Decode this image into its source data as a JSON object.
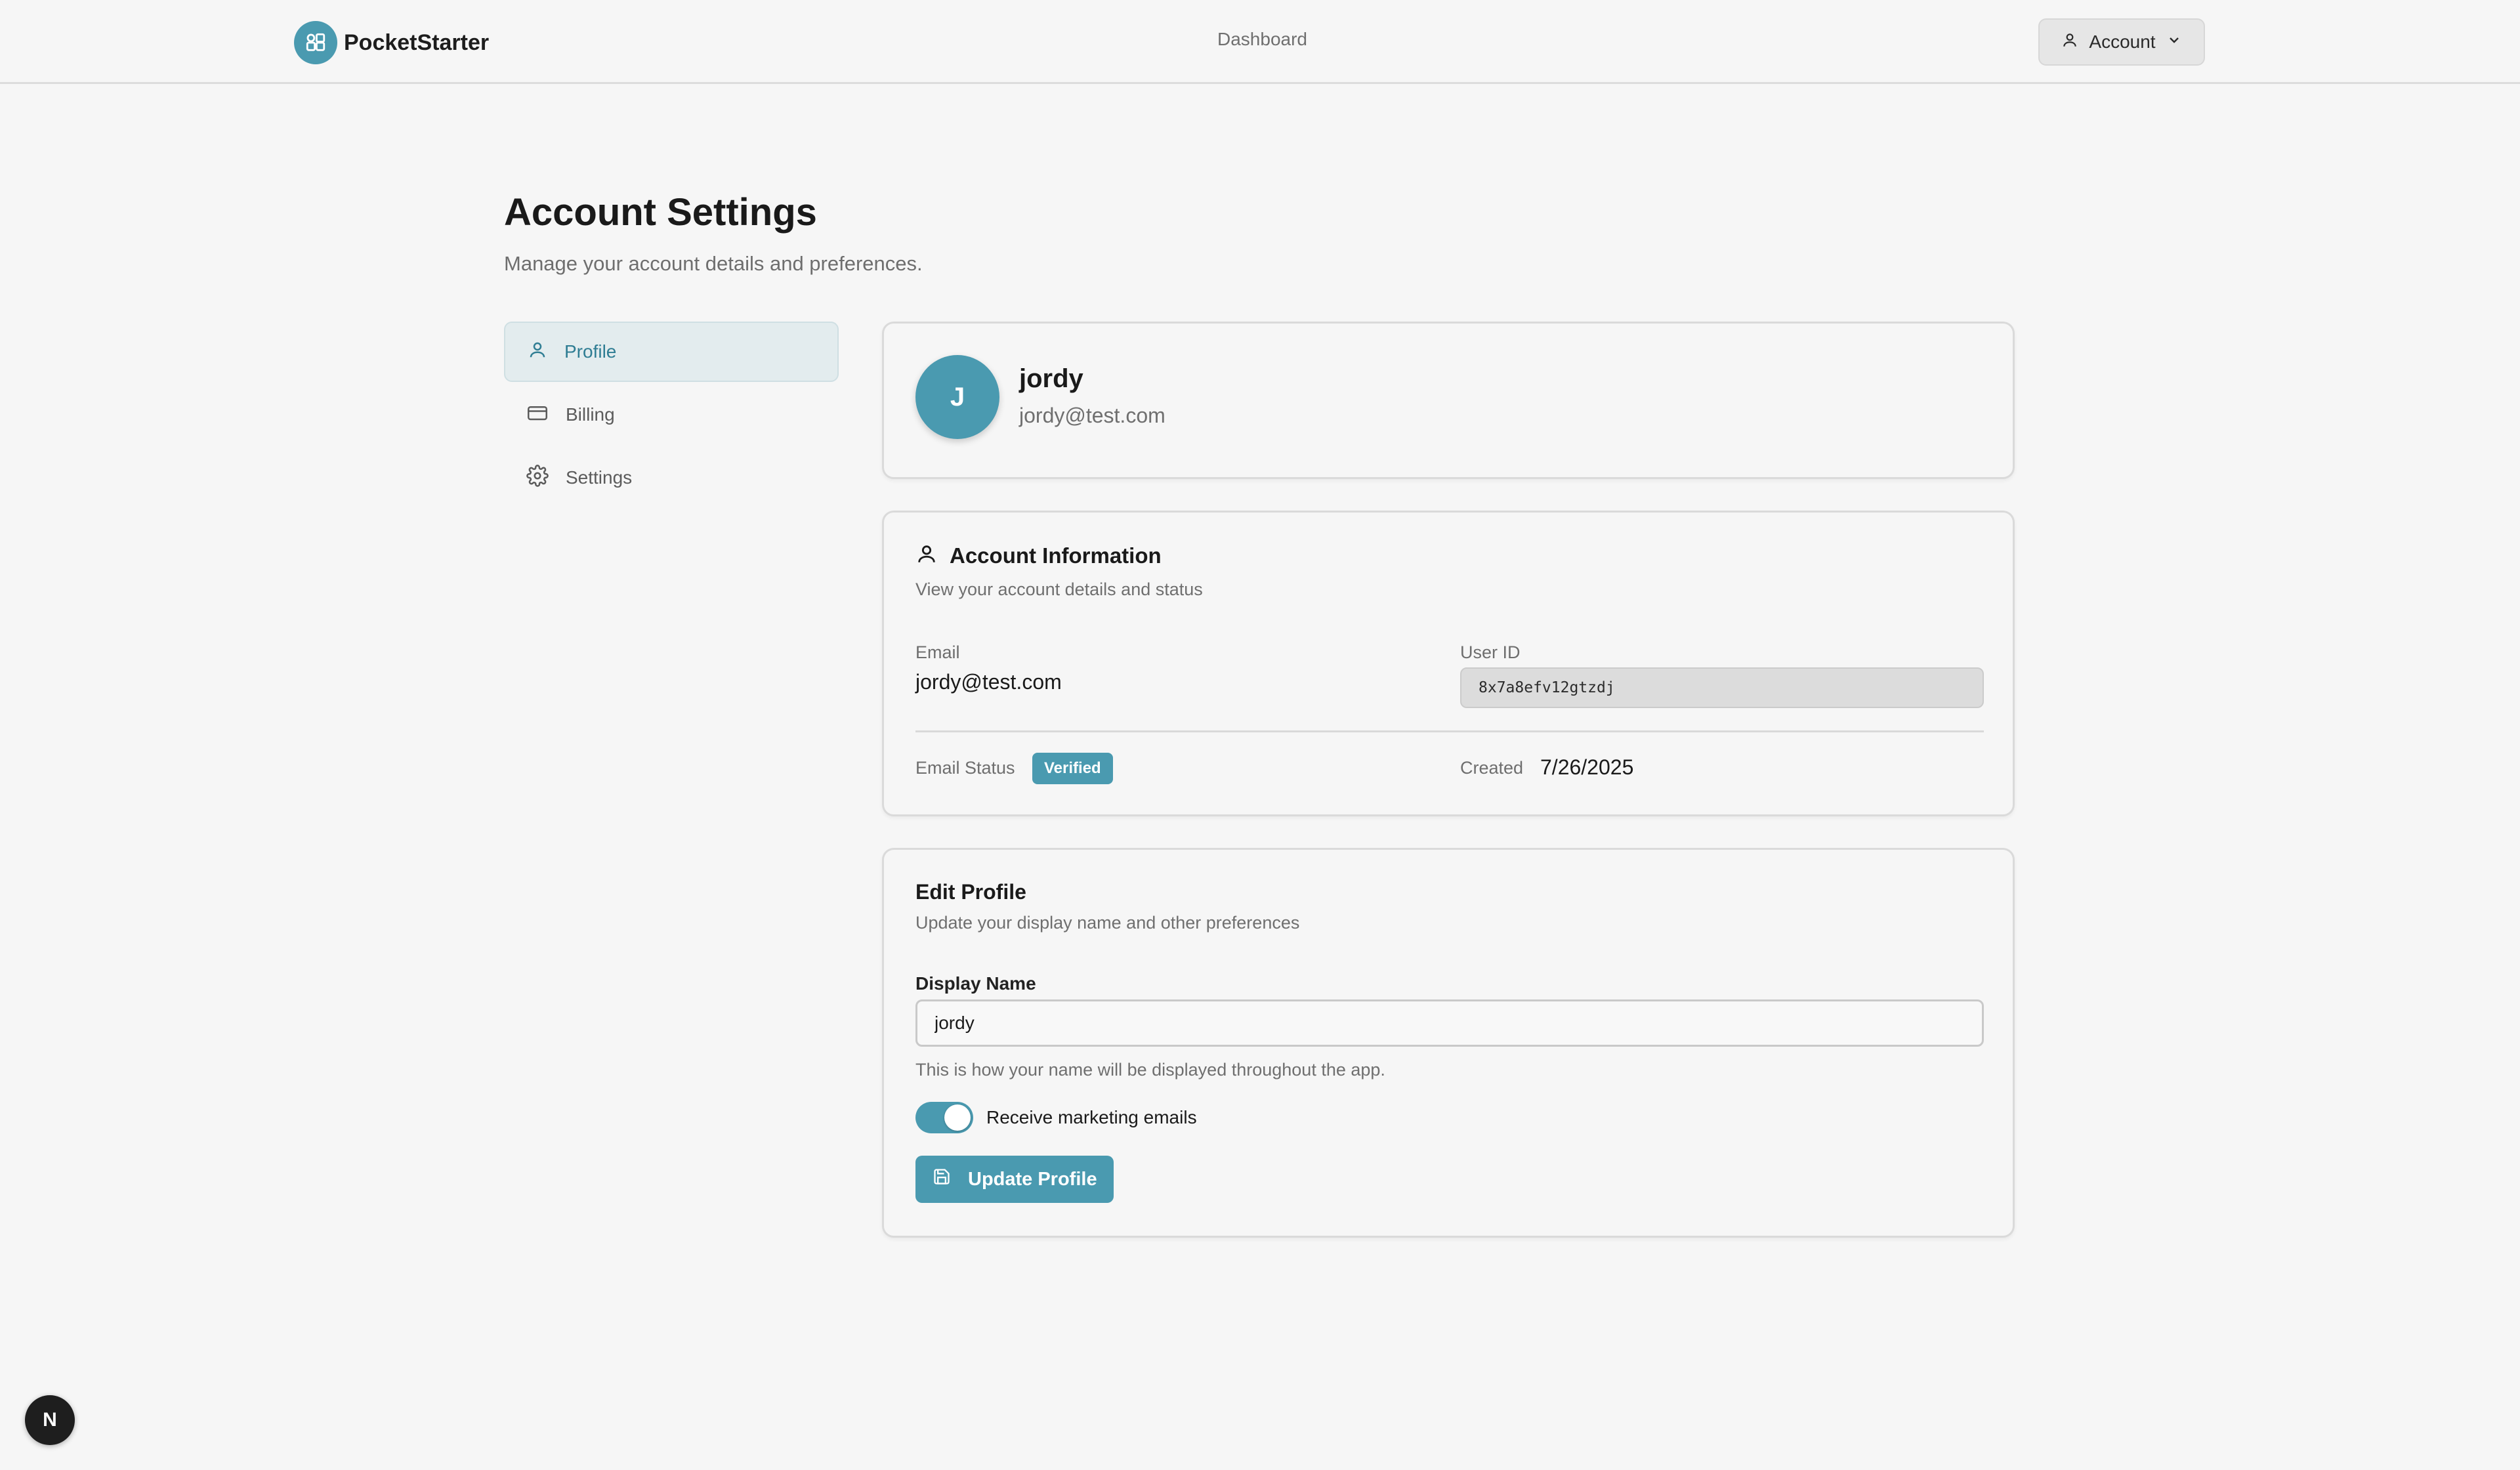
{
  "brand": {
    "name": "PocketStarter",
    "accent": "#4a9ab0"
  },
  "nav": {
    "dashboard": "Dashboard",
    "account": "Account"
  },
  "page": {
    "title": "Account Settings",
    "subtitle": "Manage your account details and preferences."
  },
  "sidebar": {
    "items": [
      {
        "label": "Profile",
        "icon": "user-icon",
        "active": true
      },
      {
        "label": "Billing",
        "icon": "credit-card-icon",
        "active": false
      },
      {
        "label": "Settings",
        "icon": "gear-icon",
        "active": false
      }
    ]
  },
  "profile": {
    "initial": "J",
    "name": "jordy",
    "email": "jordy@test.com"
  },
  "account_info": {
    "title": "Account Information",
    "subtitle": "View your account details and status",
    "email_label": "Email",
    "email_value": "jordy@test.com",
    "user_id_label": "User ID",
    "user_id_value": "8x7a8efv12gtzdj",
    "email_status_label": "Email Status",
    "email_status_badge": "Verified",
    "created_label": "Created",
    "created_value": "7/26/2025"
  },
  "edit_profile": {
    "title": "Edit Profile",
    "subtitle": "Update your display name and other preferences",
    "display_name_label": "Display Name",
    "display_name_value": "jordy",
    "display_name_hint": "This is how your name will be displayed throughout the app.",
    "marketing_toggle_label": "Receive marketing emails",
    "marketing_toggle_on": true,
    "update_button": "Update Profile"
  },
  "dev_badge": "N"
}
